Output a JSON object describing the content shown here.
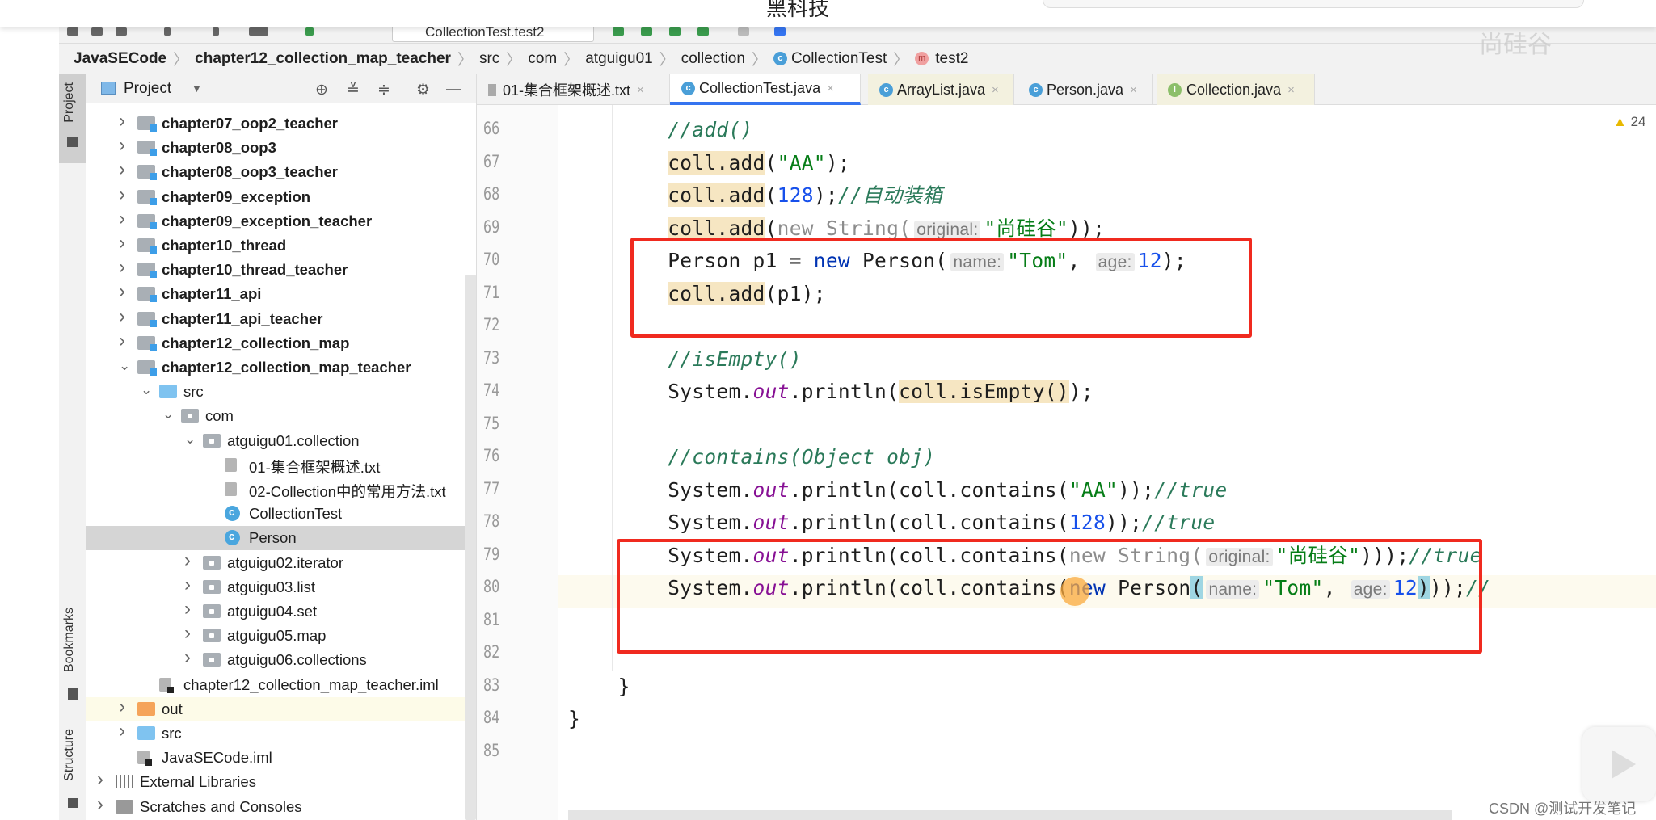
{
  "topbar": {
    "title": "黑科技"
  },
  "watermark": "尚硅谷",
  "toolbar": {
    "run_config": "CollectionTest.test2"
  },
  "breadcrumb": [
    {
      "label": "JavaSECode",
      "bold": true
    },
    {
      "label": "chapter12_collection_map_teacher",
      "bold": true
    },
    {
      "label": "src"
    },
    {
      "label": "com"
    },
    {
      "label": "atguigu01"
    },
    {
      "label": "collection"
    },
    {
      "label": "CollectionTest",
      "icon": "class-icon"
    },
    {
      "label": "test2",
      "icon": "method-icon"
    }
  ],
  "strip": {
    "project": "Project",
    "bookmarks": "Bookmarks",
    "structure": "Structure"
  },
  "project_panel": {
    "title": "Project",
    "rows": [
      {
        "label": "chapter07_oop2_teacher",
        "level": 0,
        "chev": "right",
        "icon": "mod",
        "bold": true
      },
      {
        "label": "chapter08_oop3",
        "level": 0,
        "chev": "right",
        "icon": "mod",
        "bold": true
      },
      {
        "label": "chapter08_oop3_teacher",
        "level": 0,
        "chev": "right",
        "icon": "mod",
        "bold": true
      },
      {
        "label": "chapter09_exception",
        "level": 0,
        "chev": "right",
        "icon": "mod",
        "bold": true
      },
      {
        "label": "chapter09_exception_teacher",
        "level": 0,
        "chev": "right",
        "icon": "mod",
        "bold": true
      },
      {
        "label": "chapter10_thread",
        "level": 0,
        "chev": "right",
        "icon": "mod",
        "bold": true
      },
      {
        "label": "chapter10_thread_teacher",
        "level": 0,
        "chev": "right",
        "icon": "mod",
        "bold": true
      },
      {
        "label": "chapter11_api",
        "level": 0,
        "chev": "right",
        "icon": "mod",
        "bold": true
      },
      {
        "label": "chapter11_api_teacher",
        "level": 0,
        "chev": "right",
        "icon": "mod",
        "bold": true
      },
      {
        "label": "chapter12_collection_map",
        "level": 0,
        "chev": "right",
        "icon": "mod",
        "bold": true
      },
      {
        "label": "chapter12_collection_map_teacher",
        "level": 0,
        "chev": "down",
        "icon": "mod",
        "bold": true
      },
      {
        "label": "src",
        "level": 1,
        "chev": "down",
        "icon": "srcf"
      },
      {
        "label": "com",
        "level": 2,
        "chev": "down",
        "icon": "pkg"
      },
      {
        "label": "atguigu01.collection",
        "level": 3,
        "chev": "down",
        "icon": "pkg"
      },
      {
        "label": "01-集合框架概述.txt",
        "level": 4,
        "chev": "",
        "icon": "file"
      },
      {
        "label": "02-Collection中的常用方法.txt",
        "level": 4,
        "chev": "",
        "icon": "file"
      },
      {
        "label": "CollectionTest",
        "level": 4,
        "chev": "",
        "icon": "cls"
      },
      {
        "label": "Person",
        "level": 4,
        "chev": "",
        "icon": "cls",
        "selected": true
      },
      {
        "label": "atguigu02.iterator",
        "level": 3,
        "chev": "right",
        "icon": "pkg"
      },
      {
        "label": "atguigu03.list",
        "level": 3,
        "chev": "right",
        "icon": "pkg"
      },
      {
        "label": "atguigu04.set",
        "level": 3,
        "chev": "right",
        "icon": "pkg"
      },
      {
        "label": "atguigu05.map",
        "level": 3,
        "chev": "right",
        "icon": "pkg"
      },
      {
        "label": "atguigu06.collections",
        "level": 3,
        "chev": "right",
        "icon": "pkg"
      },
      {
        "label": "chapter12_collection_map_teacher.iml",
        "level": 1,
        "chev": "",
        "icon": "iml"
      },
      {
        "label": "out",
        "level": 0,
        "chev": "right",
        "icon": "outf",
        "highlight": true
      },
      {
        "label": "src",
        "level": 0,
        "chev": "right",
        "icon": "srcf"
      },
      {
        "label": "JavaSECode.iml",
        "level": 0,
        "chev": "",
        "icon": "iml"
      },
      {
        "label": "External Libraries",
        "level": -1,
        "chev": "right",
        "icon": "lib"
      },
      {
        "label": "Scratches and Consoles",
        "level": -1,
        "chev": "right",
        "icon": "scr"
      }
    ]
  },
  "tabs": [
    {
      "label": "01-集合框架概述.txt",
      "icon": "txt"
    },
    {
      "label": "CollectionTest.java",
      "icon": "class",
      "active": true
    },
    {
      "label": "ArrayList.java",
      "icon": "class",
      "library": true
    },
    {
      "label": "Person.java",
      "icon": "class"
    },
    {
      "label": "Collection.java",
      "icon": "interface",
      "library": true
    }
  ],
  "editor": {
    "warnings": "24",
    "lines": [
      {
        "n": "66",
        "indent": 8,
        "tokens": [
          [
            "//add()",
            "com"
          ]
        ]
      },
      {
        "n": "67",
        "indent": 8,
        "tokens": [
          [
            "coll.add",
            "hlt"
          ],
          [
            "(",
            ""
          ],
          [
            "\"AA\"",
            "str"
          ],
          [
            ");",
            ""
          ]
        ]
      },
      {
        "n": "68",
        "indent": 8,
        "tokens": [
          [
            "coll.add",
            "hlt"
          ],
          [
            "(",
            ""
          ],
          [
            "128",
            "num"
          ],
          [
            ");",
            ""
          ],
          [
            "//自动装箱",
            "com"
          ]
        ]
      },
      {
        "n": "69",
        "indent": 8,
        "tokens": [
          [
            "coll.add",
            "hlt"
          ],
          [
            "(",
            ""
          ],
          [
            "new String(",
            "gray"
          ],
          [
            "original:",
            "hint"
          ],
          [
            "\"尚硅谷\"",
            "str"
          ],
          [
            "));",
            ""
          ]
        ]
      },
      {
        "n": "70",
        "indent": 8,
        "tokens": [
          [
            "Person p1 = ",
            ""
          ],
          [
            "new",
            "kw"
          ],
          [
            " Person(",
            ""
          ],
          [
            "name:",
            "hint"
          ],
          [
            "\"Tom\"",
            "str"
          ],
          [
            ", ",
            ""
          ],
          [
            "age:",
            "hint"
          ],
          [
            "12",
            "num"
          ],
          [
            ");",
            ""
          ]
        ]
      },
      {
        "n": "71",
        "indent": 8,
        "tokens": [
          [
            "coll.add",
            "hlt"
          ],
          [
            "(p1);",
            ""
          ]
        ]
      },
      {
        "n": "72",
        "indent": 0,
        "tokens": []
      },
      {
        "n": "73",
        "indent": 8,
        "tokens": [
          [
            "//isEmpty()",
            "com"
          ]
        ]
      },
      {
        "n": "74",
        "indent": 8,
        "tokens": [
          [
            "System.",
            ""
          ],
          [
            "out",
            "out"
          ],
          [
            ".println(",
            ""
          ],
          [
            "coll.isEmpty()",
            "hlt"
          ],
          [
            ");",
            ""
          ]
        ]
      },
      {
        "n": "75",
        "indent": 0,
        "tokens": []
      },
      {
        "n": "76",
        "indent": 8,
        "tokens": [
          [
            "//contains(Object obj)",
            "com"
          ]
        ]
      },
      {
        "n": "77",
        "indent": 8,
        "tokens": [
          [
            "System.",
            ""
          ],
          [
            "out",
            "out"
          ],
          [
            ".println(coll.contains(",
            ""
          ],
          [
            "\"AA\"",
            "str"
          ],
          [
            "));",
            ""
          ],
          [
            "//true",
            "com"
          ]
        ]
      },
      {
        "n": "78",
        "indent": 8,
        "tokens": [
          [
            "System.",
            ""
          ],
          [
            "out",
            "out"
          ],
          [
            ".println(coll.contains(",
            ""
          ],
          [
            "128",
            "num"
          ],
          [
            "));",
            ""
          ],
          [
            "//true",
            "com"
          ]
        ]
      },
      {
        "n": "79",
        "indent": 8,
        "tokens": [
          [
            "System.",
            ""
          ],
          [
            "out",
            "out"
          ],
          [
            ".println(coll.contains(",
            ""
          ],
          [
            "new String(",
            "gray"
          ],
          [
            "original:",
            "hint"
          ],
          [
            "\"尚硅谷\"",
            "str"
          ],
          [
            ")));",
            ""
          ],
          [
            "//true",
            "com"
          ]
        ]
      },
      {
        "n": "80",
        "indent": 8,
        "tokens": [
          [
            "System.",
            ""
          ],
          [
            "out",
            "out"
          ],
          [
            ".println(coll.contains(",
            ""
          ],
          [
            "new",
            "kw"
          ],
          [
            " Person",
            ""
          ],
          [
            "(",
            "brk"
          ],
          [
            "name:",
            "hint"
          ],
          [
            "\"Tom\"",
            "str"
          ],
          [
            ", ",
            ""
          ],
          [
            "age:",
            "hint"
          ],
          [
            "12",
            "num"
          ],
          [
            ")",
            "brk"
          ],
          [
            "));",
            ""
          ],
          [
            "//",
            "com"
          ]
        ]
      },
      {
        "n": "81",
        "indent": 0,
        "tokens": []
      },
      {
        "n": "82",
        "indent": 0,
        "tokens": []
      },
      {
        "n": "83",
        "indent": 4,
        "tokens": [
          [
            "}",
            ""
          ]
        ]
      },
      {
        "n": "84",
        "indent": 0,
        "tokens": [
          [
            "}",
            ""
          ]
        ]
      },
      {
        "n": "85",
        "indent": 0,
        "tokens": []
      }
    ]
  },
  "csdn": "CSDN @测试开发笔记",
  "colors": {
    "accent": "#3574f0",
    "annotation_box": "#f02a1f",
    "warning": "#e8b900"
  }
}
